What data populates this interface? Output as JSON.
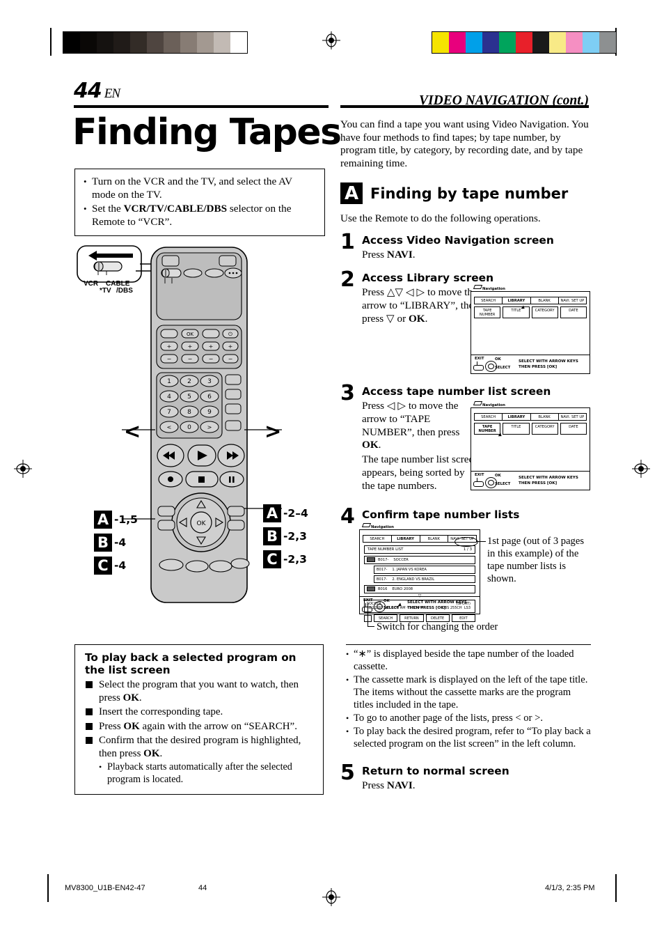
{
  "header": {
    "page_number": "44",
    "lang_code": "EN",
    "running_head": "VIDEO NAVIGATION (cont.)"
  },
  "left": {
    "title": "Finding Tapes",
    "prep": [
      "Turn on the VCR and the TV, and select the AV mode on the TV.",
      "Set the VCR/TV/CABLE/DBS selector on the Remote to “VCR”."
    ],
    "prep_bold_terms": [
      "VCR/TV/CABLE/DBS"
    ],
    "selector_callout": {
      "label_left": "VCR",
      "label_left_sub": "*TV",
      "label_right": "CABLE",
      "label_right_sub": "/DBS"
    },
    "remote_labels_left": [
      {
        "chip": "A",
        "steps": "-1,5"
      },
      {
        "chip": "B",
        "steps": "-4"
      },
      {
        "chip": "C",
        "steps": "-4"
      }
    ],
    "remote_labels_right": [
      {
        "chip": "A",
        "steps": "-2–4"
      },
      {
        "chip": "B",
        "steps": "-2,3"
      },
      {
        "chip": "C",
        "steps": "-2,3"
      }
    ],
    "page_keys": {
      "prev": "<",
      "next": ">"
    },
    "playback_box": {
      "heading": "To play back a selected program on the list screen",
      "steps": [
        "Select the program that you want to watch, then press OK.",
        "Insert the corresponding tape.",
        "Press OK again with the arrow on “SEARCH”.",
        "Confirm that the desired program is highlighted, then press OK."
      ],
      "note": "Playback starts automatically after the selected program is located."
    }
  },
  "right": {
    "intro": "You can find a tape you want using Video Navigation. You have four methods to find tapes; by tape number, by program title, by category, by recording date, and by tape remaining time.",
    "section": {
      "chip": "A",
      "title": "Finding by tape number",
      "subtitle": "Use the Remote to do the following operations."
    },
    "steps": [
      {
        "num": "1",
        "heading": "Access Video Navigation screen",
        "text": "Press NAVI."
      },
      {
        "num": "2",
        "heading": "Access Library screen",
        "text": "Press △▽ ◁ ▷ to move the arrow to “LIBRARY”, then press ▽ or OK."
      },
      {
        "num": "3",
        "heading": "Access tape number list screen",
        "text": "Press ◁ ▷ to move the arrow to “TAPE NUMBER”, then press OK.",
        "text2": "The tape number list screen appears, being sorted by the tape numbers."
      },
      {
        "num": "4",
        "heading": "Confirm tape number lists"
      },
      {
        "num": "5",
        "heading": "Return to normal screen",
        "text": "Press NAVI."
      }
    ],
    "annotations": {
      "page_note": "1st page (out of 3 pages in this example) of the tape number lists is shown.",
      "switch_note": "Switch for changing the order"
    },
    "notes": [
      "“∗” is displayed beside the tape number of the loaded cassette.",
      "The cassette mark is displayed on the left of the tape title. The items without the cassette marks are the program titles included in the tape.",
      "To go to another page of the lists, press < or >.",
      "To play back the desired program, refer to “To play back a selected program on the list screen” in the left column."
    ]
  },
  "osd": {
    "nav_label": "Navigation",
    "tabs": [
      "SEARCH",
      "LIBRARY",
      "BLANK",
      "NAVI. SET UP"
    ],
    "selected_tab": "LIBRARY",
    "fields": [
      "TAPE NUMBER",
      "TITLE",
      "CATEGORY",
      "DATE"
    ],
    "footer": {
      "exit": "EXIT",
      "ok": "OK",
      "select": "SELECT",
      "hint_line1": "SELECT WITH ARROW KEYS",
      "hint_line2": "THEN PRESS [OK]"
    },
    "list_screen": {
      "list_title": "TAPE NUMBER LIST",
      "page_indicator": "1 / 3",
      "rows": [
        {
          "cassette": true,
          "number": "B017-",
          "title": "SOCCER"
        },
        {
          "cassette": false,
          "number": "B017-",
          "title": "1. JAPAN VS KOREA"
        },
        {
          "cassette": false,
          "number": "B017-",
          "title": "2. ENGLAND VS BRAZIL"
        },
        {
          "cassette": true,
          "number": "B016",
          "title": "EURO 2008"
        }
      ],
      "info": {
        "title": "SOCCER",
        "datetime": "12/21/00 SAT   6:30 AM – 5:53 PM",
        "category": "(SPORT)",
        "channel": "DBS 255CH",
        "speed": "LS3"
      },
      "buttons": [
        "SEARCH",
        "RETURN",
        "DELETE",
        "EDIT"
      ]
    }
  },
  "footer": {
    "file_id": "MV8300_U1B-EN42-47",
    "page": "44",
    "timestamp": "4/1/3, 2:35 PM"
  },
  "calibration": {
    "gray_ramp": [
      "#000000",
      "#0a0806",
      "#151210",
      "#201b18",
      "#332c27",
      "#4f4540",
      "#6b6059",
      "#877c74",
      "#a39991",
      "#c2bab4",
      "#ffffff"
    ],
    "color_patches": [
      "#f5e400",
      "#e8007d",
      "#00a0e9",
      "#2b3190",
      "#00a45c",
      "#e8202a",
      "#1a1a1a",
      "#f8ea87",
      "#f58fc2",
      "#7ecef4",
      "#8d9091"
    ]
  }
}
